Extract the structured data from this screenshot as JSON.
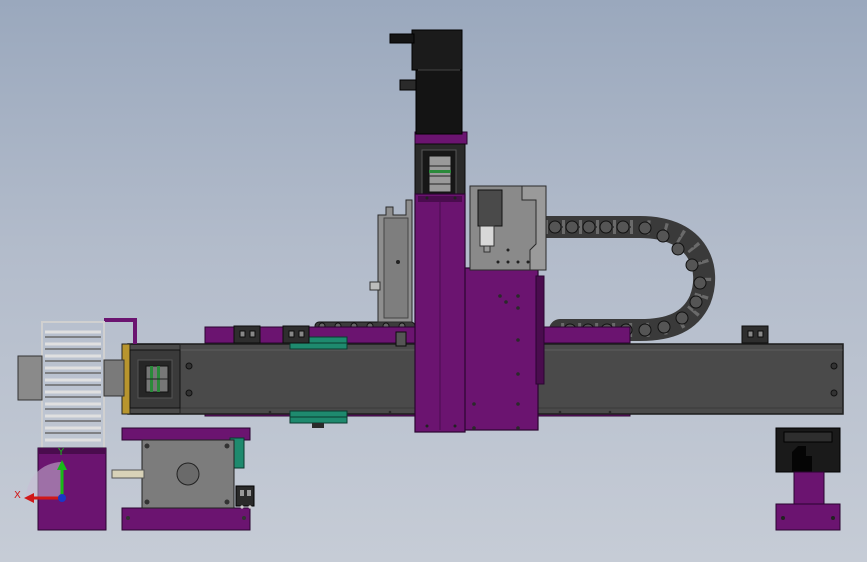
{
  "viewport": {
    "background_top": "#9aa8bd",
    "background_bottom": "#c6ccd6"
  },
  "colors": {
    "purple": "#6b1470",
    "purple_dark": "#4a0c4e",
    "gray_body": "#4a4a4a",
    "gray_dark": "#2b2b2b",
    "gray_light": "#8c8c8c",
    "green_rail": "#1e8a6e",
    "gold": "#b8952e",
    "black": "#121212"
  },
  "triad": {
    "x_label": "X",
    "y_label": "Y",
    "x_color": "#d01818",
    "y_color": "#18b818",
    "z_color": "#1838c8"
  }
}
